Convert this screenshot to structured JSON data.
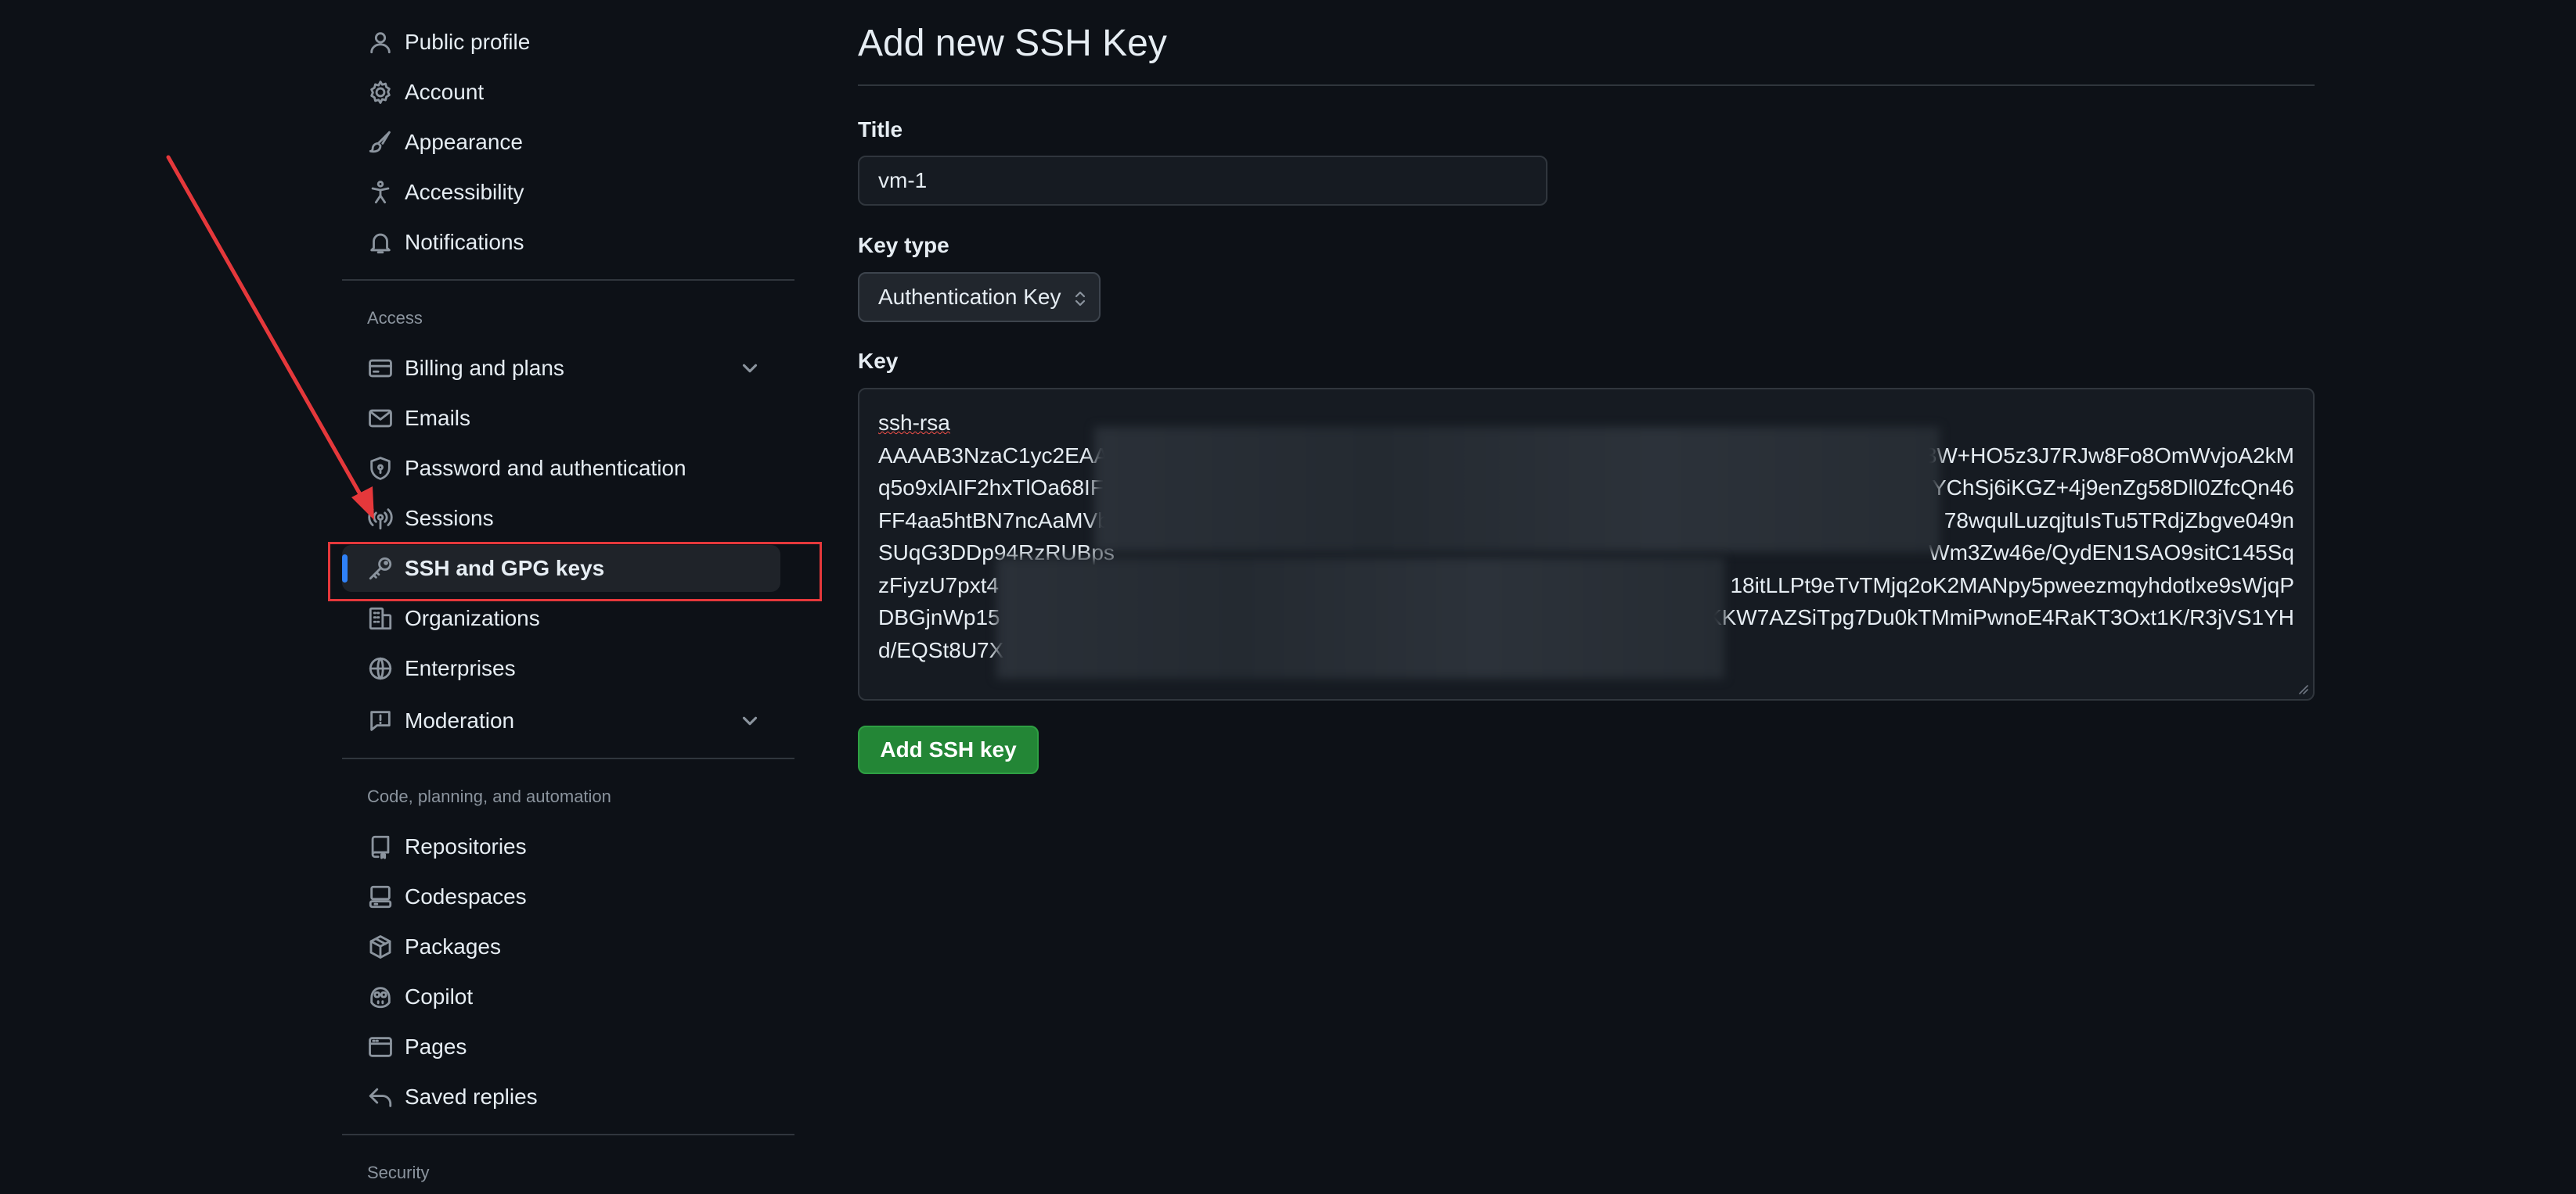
{
  "sidebar": {
    "items_top": [
      {
        "label": "Public profile",
        "icon": "person-icon"
      },
      {
        "label": "Account",
        "icon": "gear-icon"
      },
      {
        "label": "Appearance",
        "icon": "paintbrush-icon"
      },
      {
        "label": "Accessibility",
        "icon": "accessibility-icon"
      },
      {
        "label": "Notifications",
        "icon": "bell-icon"
      }
    ],
    "access_title": "Access",
    "access_items": [
      {
        "label": "Billing and plans",
        "icon": "credit-card-icon",
        "expandable": true
      },
      {
        "label": "Emails",
        "icon": "mail-icon"
      },
      {
        "label": "Password and authentication",
        "icon": "shield-lock-icon"
      },
      {
        "label": "Sessions",
        "icon": "broadcast-icon"
      },
      {
        "label": "SSH and GPG keys",
        "icon": "key-icon",
        "active": true
      },
      {
        "label": "Organizations",
        "icon": "organization-icon"
      },
      {
        "label": "Enterprises",
        "icon": "globe-icon"
      },
      {
        "label": "Moderation",
        "icon": "report-icon",
        "expandable": true
      }
    ],
    "code_title": "Code, planning, and automation",
    "code_items": [
      {
        "label": "Repositories",
        "icon": "repo-icon"
      },
      {
        "label": "Codespaces",
        "icon": "codespaces-icon"
      },
      {
        "label": "Packages",
        "icon": "package-icon"
      },
      {
        "label": "Copilot",
        "icon": "copilot-icon"
      },
      {
        "label": "Pages",
        "icon": "browser-icon"
      },
      {
        "label": "Saved replies",
        "icon": "reply-icon"
      }
    ],
    "security_title": "Security"
  },
  "main": {
    "title": "Add new SSH Key",
    "title_label": "Title",
    "title_value": "vm-1",
    "key_type_label": "Key type",
    "key_type_value": "Authentication Key",
    "key_label": "Key",
    "key_lines": [
      "ssh-rsa",
      "AAAAB3NzaC1yc2EAA",
      "q5o9xlAIF2hxTlOa68IF",
      "FF4aa5htBN7ncAaMVb",
      "SUqG3DDp94RzRUBps",
      "zFiyzU7pxt4",
      "DBGjnWp15",
      "d/EQSt8U7X"
    ],
    "key_lines_right": [
      "",
      "3W+HO5z3J7RJw8Fo8OmWvjoA2kM",
      "YChSj6iKGZ+4j9enZg58Dll0ZfcQn46",
      "78wqulLuzqjtuIsTu5TRdjZbgve049n",
      "Wm3Zw46e/QydEN1SAO9sitC145Sq",
      "18itLLPt9eTvTMjq2oK2MANpy5pweezmqyhdotlxe9sWjqP",
      "RKKW7AZSiTpg7Du0kTMmiPwnoE4RaKT3Oxt1K/R3jVS1YH",
      ""
    ],
    "submit_label": "Add SSH key"
  },
  "colors": {
    "background": "#0d1117",
    "accent_blue": "#2f81f7",
    "success_green": "#238636",
    "annotation_red": "#e5383b"
  }
}
